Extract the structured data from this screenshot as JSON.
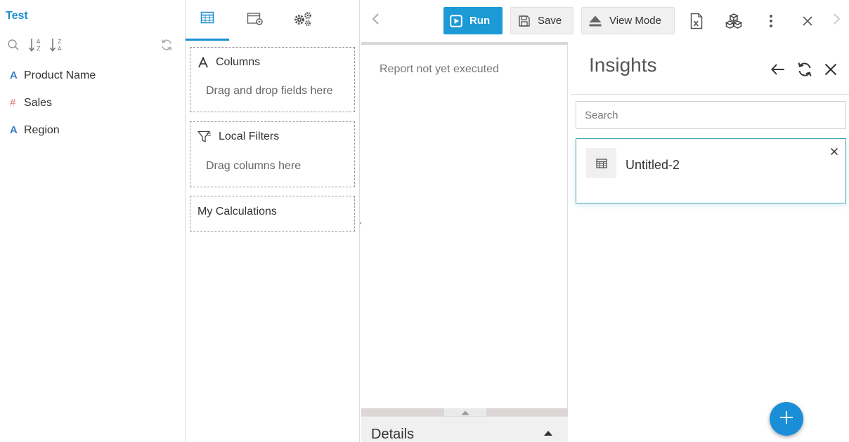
{
  "datasource": {
    "title": "Test"
  },
  "field_tools": {
    "icons": [
      "search-icon",
      "sort-az-icon",
      "sort-za-icon",
      "refresh-icon"
    ]
  },
  "fields": [
    {
      "type": "text",
      "type_glyph": "A",
      "label": "Product Name"
    },
    {
      "type": "number",
      "type_glyph": "#",
      "label": "Sales"
    },
    {
      "type": "text",
      "type_glyph": "A",
      "label": "Region"
    }
  ],
  "config": {
    "tabs": [
      {
        "icon": "table-icon",
        "active": true
      },
      {
        "icon": "window-settings-icon",
        "active": false
      },
      {
        "icon": "gears-icon",
        "active": false
      }
    ],
    "columns": {
      "title": "Columns",
      "hint": "Drag and drop fields here"
    },
    "local_filters": {
      "title": "Local Filters",
      "hint": "Drag columns here"
    },
    "my_calculations": {
      "title": "My Calculations"
    }
  },
  "toolbar": {
    "run_label": "Run",
    "save_label": "Save",
    "view_mode_label": "View Mode",
    "icons": [
      "chevron-left-icon",
      "excel-export-icon",
      "cubes-icon",
      "more-vertical-icon",
      "close-icon",
      "chevron-right-icon"
    ]
  },
  "report": {
    "status": "Report not yet executed",
    "details_label": "Details"
  },
  "insights": {
    "title": "Insights",
    "search_placeholder": "Search",
    "cards": [
      {
        "name": "Untitled-2",
        "icon": "table-icon"
      }
    ]
  },
  "colors": {
    "accent": "#1b8fd2",
    "run_button": "#1b9ad6",
    "card_border": "#41a6b4",
    "fab": "#1a8fd8",
    "number_field": "#e07b7b",
    "text_field": "#3c7cc4"
  }
}
